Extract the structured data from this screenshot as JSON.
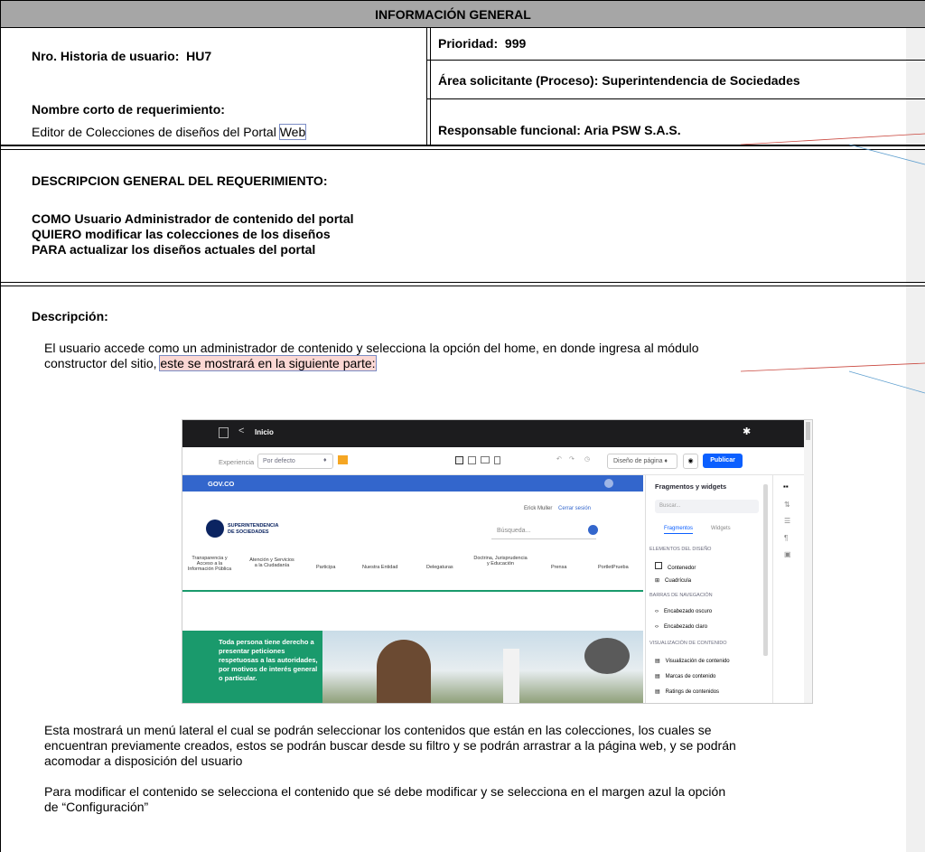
{
  "info": {
    "header": "INFORMACIÓN GENERAL",
    "story_label": "Nro. Historia de usuario:",
    "story_value": "HU7",
    "priority_label": "Prioridad:",
    "priority_value": "999",
    "area": "Área solicitante (Proceso): Superintendencia de Sociedades",
    "short_name_label": "Nombre corto de requerimiento:",
    "short_name_main": "Editor de Colecciones de diseños del Portal ",
    "short_name_tail": "Web",
    "responsible": "Responsable funcional: Aria PSW S.A.S."
  },
  "requirement": {
    "title": "DESCRIPCION GENERAL DEL REQUERIMIENTO:",
    "como": "COMO Usuario Administrador de contenido del portal",
    "quiero": "QUIERO modificar las colecciones de los diseños",
    "para": "PARA actualizar los diseños actuales del portal"
  },
  "description": {
    "title": "Descripción:",
    "p1_line1": "El usuario accede como un administrador de contenido y selecciona la opción del home, en donde ingresa al módulo",
    "p1_line2_a": "constructor del sitio, ",
    "p1_line2_b": "este se mostrará en la siguiente parte:",
    "p2_line1": "Esta mostrará un menú lateral el cual se podrán seleccionar los contenidos que están en las colecciones, los cuales se",
    "p2_line2": "encuentran previamente creados, estos se podrán buscar desde su filtro y se podrán arrastrar a la página web, y se podrán",
    "p2_line3": "acomodar a disposición del usuario",
    "p3_line1": "Para modificar el contenido se selecciona el contenido que sé debe modificar y se selecciona en el margen azul la opción",
    "p3_line2": "de “Configuración”"
  },
  "screenshot": {
    "top_title": "Inicio",
    "experience_label": "Experiencia",
    "experience_value": "Por defecto",
    "design_select": "Diseño de página ♦",
    "publish": "Publicar",
    "govco": "GOV.CO",
    "user_name": "Erick Muller",
    "logout": "Cerrar sesión",
    "logo_line1": "SUPERINTENDENCIA",
    "logo_line2": "DE SOCIEDADES",
    "search_placeholder": "Búsqueda...",
    "nav": [
      "Transparencia y Acceso a la Información Pública",
      "Atención y Servicios a la Ciudadanía",
      "Participa",
      "Nuestra Entidad",
      "Delegaturas",
      "Doctrina, Jurisprudencia y Educación",
      "Prensa",
      "PortletPrueba"
    ],
    "hero_text": "Toda persona tiene derecho a presentar peticiones respetuosas a las autoridades, por motivos de interés general o particular.",
    "panel_title": "Fragmentos y widgets",
    "panel_search": "Buscar...",
    "tab_fragments": "Fragmentos",
    "tab_widgets": "Widgets",
    "sections": [
      {
        "title": "ELEMENTOS DEL DISEÑO",
        "items": [
          "Contenedor",
          "Cuadrícula"
        ]
      },
      {
        "title": "BARRAS DE NAVEGACIÓN",
        "items": [
          "Encabezado oscuro",
          "Encabezado claro"
        ]
      },
      {
        "title": "VISUALIZACIÓN DE CONTENIDO",
        "items": [
          "Visualización de contenido",
          "Marcas de contenido",
          "Ratings de contenidos"
        ]
      }
    ],
    "colors": {
      "top_bar": "#1c1c1e",
      "gov_blue": "#3366cc",
      "hero_green": "#1a9a6c",
      "accent": "#0b5fff"
    }
  }
}
